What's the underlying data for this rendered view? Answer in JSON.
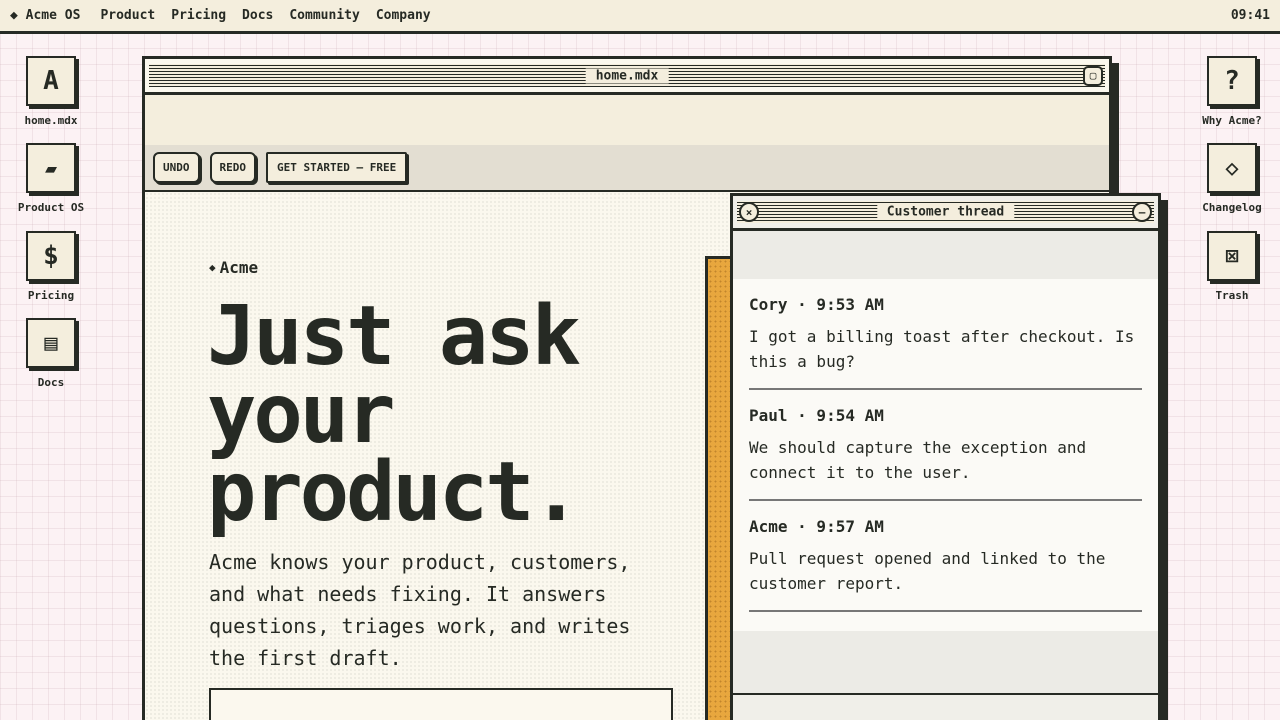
{
  "menubar": {
    "brand": "◆ Acme OS",
    "items": [
      "Product",
      "Pricing",
      "Docs",
      "Community",
      "Company"
    ],
    "clock": "09:41"
  },
  "desktop_left": [
    {
      "glyph": "A",
      "label": "home.mdx",
      "icon": "document-a-icon"
    },
    {
      "glyph": "▰",
      "label": "Product OS",
      "icon": "product-icon"
    },
    {
      "glyph": "$",
      "label": "Pricing",
      "icon": "dollar-icon"
    },
    {
      "glyph": "▤",
      "label": "Docs",
      "icon": "docs-icon"
    }
  ],
  "desktop_right": [
    {
      "glyph": "?",
      "label": "Why Acme?",
      "icon": "question-icon"
    },
    {
      "glyph": "◇",
      "label": "Changelog",
      "icon": "changelog-icon"
    },
    {
      "glyph": "⊠",
      "label": "Trash",
      "icon": "trash-icon"
    }
  ],
  "main_window": {
    "title": "home.mdx",
    "maximize_glyph": "▢",
    "toolbar": {
      "undo": "UNDO",
      "redo": "REDO",
      "cta": "GET STARTED — FREE"
    },
    "eyebrow_diamond": "◆",
    "eyebrow": "Acme",
    "headline": "Just ask your product.",
    "lede": "Acme knows your product, customers, and what needs fixing. It answers questions, triages work, and writes the first draft."
  },
  "chat_window": {
    "title": "Customer thread",
    "close_glyph": "×",
    "minimize_glyph": "–",
    "messages": [
      {
        "author": "Cory · 9:53 AM",
        "text": "I got a billing toast after checkout. Is this a bug?"
      },
      {
        "author": "Paul · 9:54 AM",
        "text": "We should capture the exception and connect it to the user."
      },
      {
        "author": "Acme · 9:57 AM",
        "text": "Pull request opened and linked to the customer report."
      }
    ]
  },
  "colors": {
    "accent": "#e8a73e",
    "ink": "#262a24",
    "paper": "#f4eedd",
    "desktop": "#fcf2f4"
  }
}
